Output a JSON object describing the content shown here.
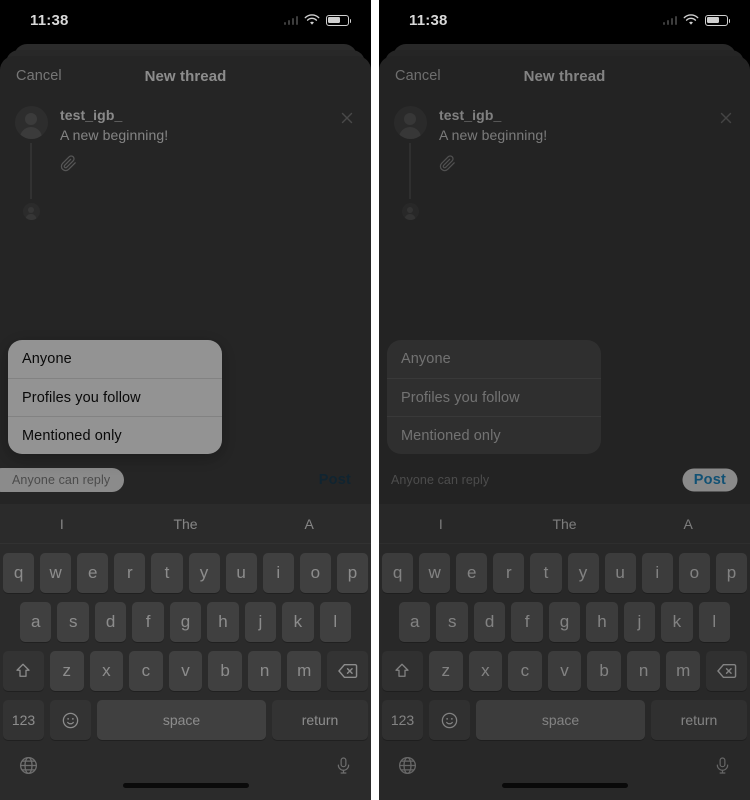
{
  "meta": {
    "app": "Threads",
    "screen": "New thread composer with reply-audience menu open"
  },
  "status_bar": {
    "time": "11:38",
    "cellular_icon": "signal-bars-icon",
    "wifi_icon": "wifi-icon",
    "battery_icon": "battery-icon"
  },
  "nav": {
    "cancel_label": "Cancel",
    "title": "New thread"
  },
  "composer": {
    "username": "test_igb_",
    "post_text": "A new beginning!",
    "attach_icon": "paperclip-icon",
    "close_icon": "close-icon",
    "avatar_icon": "avatar-placeholder-icon",
    "reply_avatar_icon": "avatar-placeholder-small-icon"
  },
  "audience_menu": {
    "options": [
      {
        "label": "Anyone"
      },
      {
        "label": "Profiles you follow"
      },
      {
        "label": "Mentioned only"
      }
    ]
  },
  "bottom_bar": {
    "reply_pill_label": "Anyone can reply",
    "post_label": "Post"
  },
  "keyboard": {
    "suggestions": [
      "I",
      "The",
      "A"
    ],
    "row1": [
      "q",
      "w",
      "e",
      "r",
      "t",
      "y",
      "u",
      "i",
      "o",
      "p"
    ],
    "row2": [
      "a",
      "s",
      "d",
      "f",
      "g",
      "h",
      "j",
      "k",
      "l"
    ],
    "row3_letters": [
      "z",
      "x",
      "c",
      "v",
      "b",
      "n",
      "m"
    ],
    "shift_icon": "shift-arrow-icon",
    "backspace_icon": "backspace-icon",
    "numbers_label": "123",
    "emoji_icon": "emoji-smiley-icon",
    "space_label": "space",
    "return_label": "return",
    "globe_icon": "globe-icon",
    "mic_icon": "microphone-icon"
  },
  "colors": {
    "sheet_bg": "#414141",
    "menu_bg": "#fdfdfd",
    "post_blue": "#2196d6",
    "keyboard_bg": "#4b4b4b",
    "key_bg": "#6f6f6f"
  }
}
